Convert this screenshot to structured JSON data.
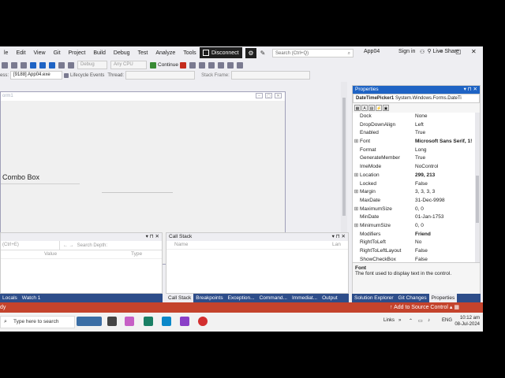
{
  "menu": [
    "le",
    "Edit",
    "View",
    "Git",
    "Project",
    "Build",
    "Debug",
    "Test",
    "Analyze",
    "Tools",
    "Ex"
  ],
  "disconnect_label": "Disconnect",
  "search_placeholder": "Search (Ctrl+Q)",
  "app_name": "App04",
  "sign_in": "Sign in",
  "live_share": "Live Share",
  "toolbar": {
    "debug_config": "Debug",
    "platform": "Any CPU",
    "continue": "Continue"
  },
  "toolbar2": {
    "process_prefix": "ess:",
    "process": "[9188] App04.exe",
    "lifecycle": "Lifecycle Events",
    "thread": "Thread:",
    "stack_frame": "Stack Frame:"
  },
  "designer": {
    "form_title": "orm1",
    "combo_label": "Combo Box"
  },
  "properties": {
    "title": "Properties",
    "object_name": "DateTimePicker1",
    "object_type": "System.Windows.Forms.DateTi",
    "rows": [
      {
        "expand": "",
        "name": "Dock",
        "value": "None",
        "bold": false
      },
      {
        "expand": "",
        "name": "DropDownAlign",
        "value": "Left",
        "bold": false
      },
      {
        "expand": "",
        "name": "Enabled",
        "value": "True",
        "bold": false
      },
      {
        "expand": "⊞",
        "name": "Font",
        "value": "Microsoft Sans Serif, 1!",
        "bold": true
      },
      {
        "expand": "",
        "name": "Format",
        "value": "Long",
        "bold": false
      },
      {
        "expand": "",
        "name": "GenerateMember",
        "value": "True",
        "bold": false
      },
      {
        "expand": "",
        "name": "ImeMode",
        "value": "NoControl",
        "bold": false
      },
      {
        "expand": "⊞",
        "name": "Location",
        "value": "299, 213",
        "bold": true
      },
      {
        "expand": "",
        "name": "Locked",
        "value": "False",
        "bold": false
      },
      {
        "expand": "⊞",
        "name": "Margin",
        "value": "3, 3, 3, 3",
        "bold": false
      },
      {
        "expand": "",
        "name": "MaxDate",
        "value": "31-Dec-9998",
        "bold": false
      },
      {
        "expand": "⊞",
        "name": "MaximumSize",
        "value": "0, 0",
        "bold": false
      },
      {
        "expand": "",
        "name": "MinDate",
        "value": "01-Jan-1753",
        "bold": false
      },
      {
        "expand": "⊞",
        "name": "MinimumSize",
        "value": "0, 0",
        "bold": false
      },
      {
        "expand": "",
        "name": "Modifiers",
        "value": "Friend",
        "bold": true
      },
      {
        "expand": "",
        "name": "RightToLeft",
        "value": "No",
        "bold": false
      },
      {
        "expand": "",
        "name": "RightToLeftLayout",
        "value": "False",
        "bold": false
      },
      {
        "expand": "",
        "name": "ShowCheckBox",
        "value": "False",
        "bold": false
      }
    ],
    "desc_title": "Font",
    "desc_text": "The font used to display text in the control."
  },
  "locals": {
    "search": "(Ctrl+E)",
    "search_depth": "Search Depth:",
    "columns": [
      "Value",
      "Type"
    ]
  },
  "callstack": {
    "title": "Call Stack",
    "columns": [
      "Name",
      "Lan"
    ]
  },
  "bottom_tabs_left": [
    "Locals",
    "Watch 1"
  ],
  "bottom_tabs_mid": [
    "Call Stack",
    "Breakpoints",
    "Exception...",
    "Command...",
    "Immediat...",
    "Output"
  ],
  "bottom_tabs_right": [
    "Solution Explorer",
    "Git Changes",
    "Properties"
  ],
  "status": {
    "ready": "dy",
    "source_control": "Add to Source Control"
  },
  "taskbar": {
    "search": "Type here to search",
    "links": "Links",
    "lang": "ENG",
    "time": "10:12 am",
    "date": "08-Jul-2024"
  },
  "colors": {
    "accent": "#1e63c4",
    "status_bar": "#c4432c"
  }
}
